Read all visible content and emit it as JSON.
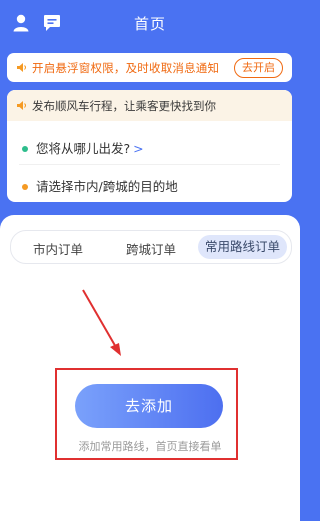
{
  "header": {
    "title": "首页",
    "left_icons": [
      "user-icon",
      "message-icon"
    ]
  },
  "notice": {
    "text": "开启悬浮窗权限，及时收取消息通知",
    "button": "去开启",
    "accent": "#f06a12"
  },
  "trip_card": {
    "header": "发布顺风车行程，让乘客更快找到你",
    "origin_prompt": "您将从哪儿出发?",
    "destination_prompt": "请选择市内/跨城的目的地"
  },
  "tabs": [
    {
      "label": "市内订单"
    },
    {
      "label": "跨城订单"
    },
    {
      "label": "常用路线订单",
      "active": true
    }
  ],
  "empty_state": {
    "button": "去添加",
    "hint": "添加常用路线，首页直接看单"
  },
  "colors": {
    "primary": "#4a72f2",
    "highlight": "#e03030"
  }
}
